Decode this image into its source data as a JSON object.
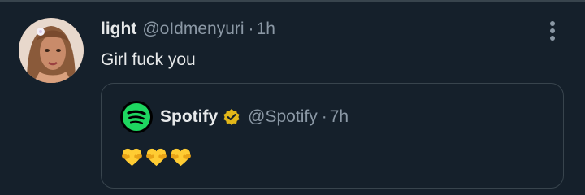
{
  "tweet": {
    "display_name": "light",
    "handle": "@oIdmenyuri",
    "separator": "·",
    "timestamp": "1h",
    "text": "Girl fuck you",
    "more_icon": "more-vertical-icon"
  },
  "quoted_tweet": {
    "display_name": "Spotify",
    "verified_badge": "verified-gold-badge-icon",
    "handle": "@Spotify",
    "separator": "·",
    "timestamp": "7h",
    "text_emoji": [
      "yellow-heart",
      "yellow-heart",
      "yellow-heart"
    ]
  },
  "colors": {
    "background": "#15202b",
    "border": "#38444d",
    "primary_text": "#e7e9ea",
    "secondary_text": "#8b98a5",
    "spotify_green": "#1ed760",
    "verified_gold": "#e2b719",
    "heart_yellow": "#ffcc33"
  }
}
